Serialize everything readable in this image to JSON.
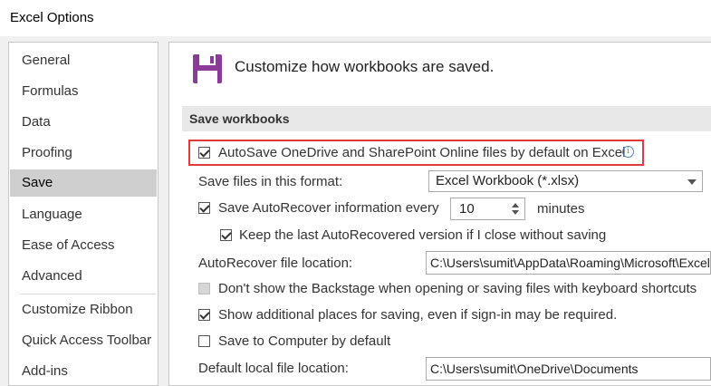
{
  "window": {
    "title": "Excel Options"
  },
  "sidebar": {
    "items": [
      {
        "label": "General"
      },
      {
        "label": "Formulas"
      },
      {
        "label": "Data"
      },
      {
        "label": "Proofing"
      },
      {
        "label": "Save",
        "selected": true
      },
      {
        "label": "Language"
      },
      {
        "label": "Ease of Access"
      },
      {
        "label": "Advanced"
      },
      {
        "label": "Customize Ribbon"
      },
      {
        "label": "Quick Access Toolbar"
      },
      {
        "label": "Add-ins"
      }
    ]
  },
  "main": {
    "header": "Customize how workbooks are saved.",
    "section_title": "Save workbooks",
    "autosave": {
      "label": "AutoSave OneDrive and SharePoint Online files by default on Excel",
      "checked": true
    },
    "format": {
      "label": "Save files in this format:",
      "value": "Excel Workbook (*.xlsx)"
    },
    "autorecover": {
      "label": "Save AutoRecover information every",
      "checked": true,
      "value": "10",
      "unit": "minutes"
    },
    "keep_last": {
      "label": "Keep the last AutoRecovered version if I close without saving",
      "checked": true
    },
    "autorecover_location": {
      "label": "AutoRecover file location:",
      "value": "C:\\Users\\sumit\\AppData\\Roaming\\Microsoft\\Excel\\"
    },
    "backstage": {
      "label": "Don't show the Backstage when opening or saving files with keyboard shortcuts",
      "checked": false
    },
    "additional_places": {
      "label": "Show additional places for saving, even if sign-in may be required.",
      "checked": true
    },
    "save_to_computer": {
      "label": "Save to Computer by default",
      "checked": false
    },
    "default_location": {
      "label": "Default local file location:",
      "value": "C:\\Users\\sumit\\OneDrive\\Documents"
    }
  },
  "colors": {
    "highlight": "#e0393e",
    "icon_purple": "#8b3c99",
    "selected_bg": "#cfcfcf"
  }
}
